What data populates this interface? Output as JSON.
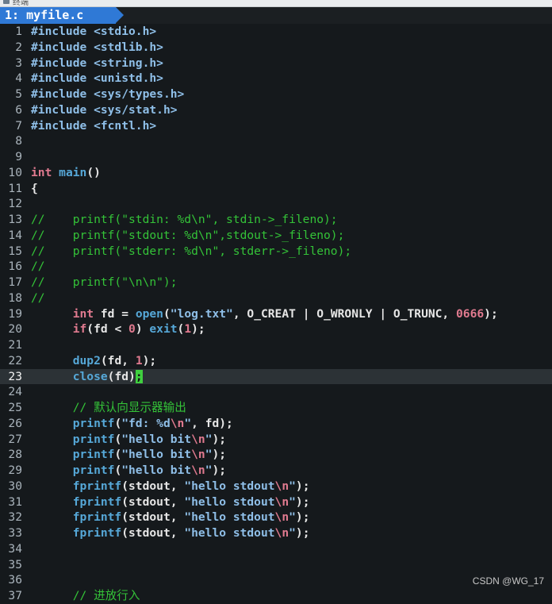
{
  "window_title": "终端",
  "tab": {
    "label": "1: myfile.c"
  },
  "watermark": "CSDN @WG_17",
  "current_line": 23,
  "colors": {
    "tab": "#2f79d6",
    "background": "#15191c",
    "comment": "#34c338",
    "keyword": "#e07a8f",
    "function": "#56a8d8",
    "string": "#8fbfe8",
    "cursor": "#3fcf3f"
  },
  "lines": [
    {
      "n": "1",
      "tokens": [
        {
          "t": "#include ",
          "c": "pp"
        },
        {
          "t": "<stdio.h>",
          "c": "st"
        }
      ]
    },
    {
      "n": "2",
      "tokens": [
        {
          "t": "#include ",
          "c": "pp"
        },
        {
          "t": "<stdlib.h>",
          "c": "st"
        }
      ]
    },
    {
      "n": "3",
      "tokens": [
        {
          "t": "#include ",
          "c": "pp"
        },
        {
          "t": "<string.h>",
          "c": "st"
        }
      ]
    },
    {
      "n": "4",
      "tokens": [
        {
          "t": "#include ",
          "c": "pp"
        },
        {
          "t": "<unistd.h>",
          "c": "st"
        }
      ]
    },
    {
      "n": "5",
      "tokens": [
        {
          "t": "#include ",
          "c": "pp"
        },
        {
          "t": "<sys/types.h>",
          "c": "st"
        }
      ]
    },
    {
      "n": "6",
      "tokens": [
        {
          "t": "#include ",
          "c": "pp"
        },
        {
          "t": "<sys/stat.h>",
          "c": "st"
        }
      ]
    },
    {
      "n": "7",
      "tokens": [
        {
          "t": "#include ",
          "c": "pp"
        },
        {
          "t": "<fcntl.h>",
          "c": "st"
        }
      ]
    },
    {
      "n": "8",
      "tokens": []
    },
    {
      "n": "9",
      "tokens": []
    },
    {
      "n": "10",
      "tokens": [
        {
          "t": "int ",
          "c": "kw"
        },
        {
          "t": "main",
          "c": "fn"
        },
        {
          "t": "()",
          "c": ""
        }
      ]
    },
    {
      "n": "11",
      "tokens": [
        {
          "t": "{",
          "c": ""
        }
      ]
    },
    {
      "n": "12",
      "tokens": []
    },
    {
      "n": "13",
      "tokens": [
        {
          "t": "//    printf(\"stdin: %d\\n\", stdin->_fileno);",
          "c": "cm"
        }
      ]
    },
    {
      "n": "14",
      "tokens": [
        {
          "t": "//    printf(\"stdout: %d\\n\",stdout->_fileno);",
          "c": "cm"
        }
      ]
    },
    {
      "n": "15",
      "tokens": [
        {
          "t": "//    printf(\"stderr: %d\\n\", stderr->_fileno);",
          "c": "cm"
        }
      ]
    },
    {
      "n": "16",
      "tokens": [
        {
          "t": "//",
          "c": "cm"
        }
      ]
    },
    {
      "n": "17",
      "tokens": [
        {
          "t": "//    printf(\"\\n\\n\");",
          "c": "cm"
        }
      ]
    },
    {
      "n": "18",
      "tokens": [
        {
          "t": "//",
          "c": "cm"
        }
      ]
    },
    {
      "n": "19",
      "tokens": [
        {
          "t": "      ",
          "c": ""
        },
        {
          "t": "int ",
          "c": "kw"
        },
        {
          "t": "fd = ",
          "c": ""
        },
        {
          "t": "open",
          "c": "fn"
        },
        {
          "t": "(",
          "c": ""
        },
        {
          "t": "\"log.txt\"",
          "c": "st"
        },
        {
          "t": ", O_CREAT | O_WRONLY | O_TRUNC, ",
          "c": ""
        },
        {
          "t": "0666",
          "c": "num"
        },
        {
          "t": ");",
          "c": ""
        }
      ]
    },
    {
      "n": "20",
      "tokens": [
        {
          "t": "      ",
          "c": ""
        },
        {
          "t": "if",
          "c": "kw"
        },
        {
          "t": "(fd < ",
          "c": ""
        },
        {
          "t": "0",
          "c": "num"
        },
        {
          "t": ") ",
          "c": ""
        },
        {
          "t": "exit",
          "c": "fn"
        },
        {
          "t": "(",
          "c": ""
        },
        {
          "t": "1",
          "c": "num"
        },
        {
          "t": ");",
          "c": ""
        }
      ]
    },
    {
      "n": "21",
      "tokens": []
    },
    {
      "n": "22",
      "tokens": [
        {
          "t": "      ",
          "c": ""
        },
        {
          "t": "dup2",
          "c": "fn"
        },
        {
          "t": "(fd, ",
          "c": ""
        },
        {
          "t": "1",
          "c": "num"
        },
        {
          "t": ");",
          "c": ""
        }
      ]
    },
    {
      "n": "23",
      "tokens": [
        {
          "t": "      ",
          "c": ""
        },
        {
          "t": "close",
          "c": "fn"
        },
        {
          "t": "(fd)",
          "c": ""
        },
        {
          "t": ";",
          "c": "cursor"
        }
      ]
    },
    {
      "n": "24",
      "tokens": []
    },
    {
      "n": "25",
      "tokens": [
        {
          "t": "      ",
          "c": ""
        },
        {
          "t": "// 默认向显示器输出",
          "c": "cm"
        }
      ]
    },
    {
      "n": "26",
      "tokens": [
        {
          "t": "      ",
          "c": ""
        },
        {
          "t": "printf",
          "c": "fn"
        },
        {
          "t": "(",
          "c": ""
        },
        {
          "t": "\"fd: %d",
          "c": "st"
        },
        {
          "t": "\\n",
          "c": "esc"
        },
        {
          "t": "\"",
          "c": "st"
        },
        {
          "t": ", fd);",
          "c": ""
        }
      ]
    },
    {
      "n": "27",
      "tokens": [
        {
          "t": "      ",
          "c": ""
        },
        {
          "t": "printf",
          "c": "fn"
        },
        {
          "t": "(",
          "c": ""
        },
        {
          "t": "\"hello bit",
          "c": "st"
        },
        {
          "t": "\\n",
          "c": "esc"
        },
        {
          "t": "\"",
          "c": "st"
        },
        {
          "t": ");",
          "c": ""
        }
      ]
    },
    {
      "n": "28",
      "tokens": [
        {
          "t": "      ",
          "c": ""
        },
        {
          "t": "printf",
          "c": "fn"
        },
        {
          "t": "(",
          "c": ""
        },
        {
          "t": "\"hello bit",
          "c": "st"
        },
        {
          "t": "\\n",
          "c": "esc"
        },
        {
          "t": "\"",
          "c": "st"
        },
        {
          "t": ");",
          "c": ""
        }
      ]
    },
    {
      "n": "29",
      "tokens": [
        {
          "t": "      ",
          "c": ""
        },
        {
          "t": "printf",
          "c": "fn"
        },
        {
          "t": "(",
          "c": ""
        },
        {
          "t": "\"hello bit",
          "c": "st"
        },
        {
          "t": "\\n",
          "c": "esc"
        },
        {
          "t": "\"",
          "c": "st"
        },
        {
          "t": ");",
          "c": ""
        }
      ]
    },
    {
      "n": "30",
      "tokens": [
        {
          "t": "      ",
          "c": ""
        },
        {
          "t": "fprintf",
          "c": "fn"
        },
        {
          "t": "(stdout, ",
          "c": ""
        },
        {
          "t": "\"hello stdout",
          "c": "st"
        },
        {
          "t": "\\n",
          "c": "esc"
        },
        {
          "t": "\"",
          "c": "st"
        },
        {
          "t": ");",
          "c": ""
        }
      ]
    },
    {
      "n": "31",
      "tokens": [
        {
          "t": "      ",
          "c": ""
        },
        {
          "t": "fprintf",
          "c": "fn"
        },
        {
          "t": "(stdout, ",
          "c": ""
        },
        {
          "t": "\"hello stdout",
          "c": "st"
        },
        {
          "t": "\\n",
          "c": "esc"
        },
        {
          "t": "\"",
          "c": "st"
        },
        {
          "t": ");",
          "c": ""
        }
      ]
    },
    {
      "n": "32",
      "tokens": [
        {
          "t": "      ",
          "c": ""
        },
        {
          "t": "fprintf",
          "c": "fn"
        },
        {
          "t": "(stdout, ",
          "c": ""
        },
        {
          "t": "\"hello stdout",
          "c": "st"
        },
        {
          "t": "\\n",
          "c": "esc"
        },
        {
          "t": "\"",
          "c": "st"
        },
        {
          "t": ");",
          "c": ""
        }
      ]
    },
    {
      "n": "33",
      "tokens": [
        {
          "t": "      ",
          "c": ""
        },
        {
          "t": "fprintf",
          "c": "fn"
        },
        {
          "t": "(stdout, ",
          "c": ""
        },
        {
          "t": "\"hello stdout",
          "c": "st"
        },
        {
          "t": "\\n",
          "c": "esc"
        },
        {
          "t": "\"",
          "c": "st"
        },
        {
          "t": ");",
          "c": ""
        }
      ]
    },
    {
      "n": "34",
      "tokens": []
    },
    {
      "n": "35",
      "tokens": []
    },
    {
      "n": "36",
      "tokens": []
    },
    {
      "n": "37",
      "tokens": [
        {
          "t": "      ",
          "c": ""
        },
        {
          "t": "// 进放行入",
          "c": "cm"
        }
      ]
    }
  ]
}
